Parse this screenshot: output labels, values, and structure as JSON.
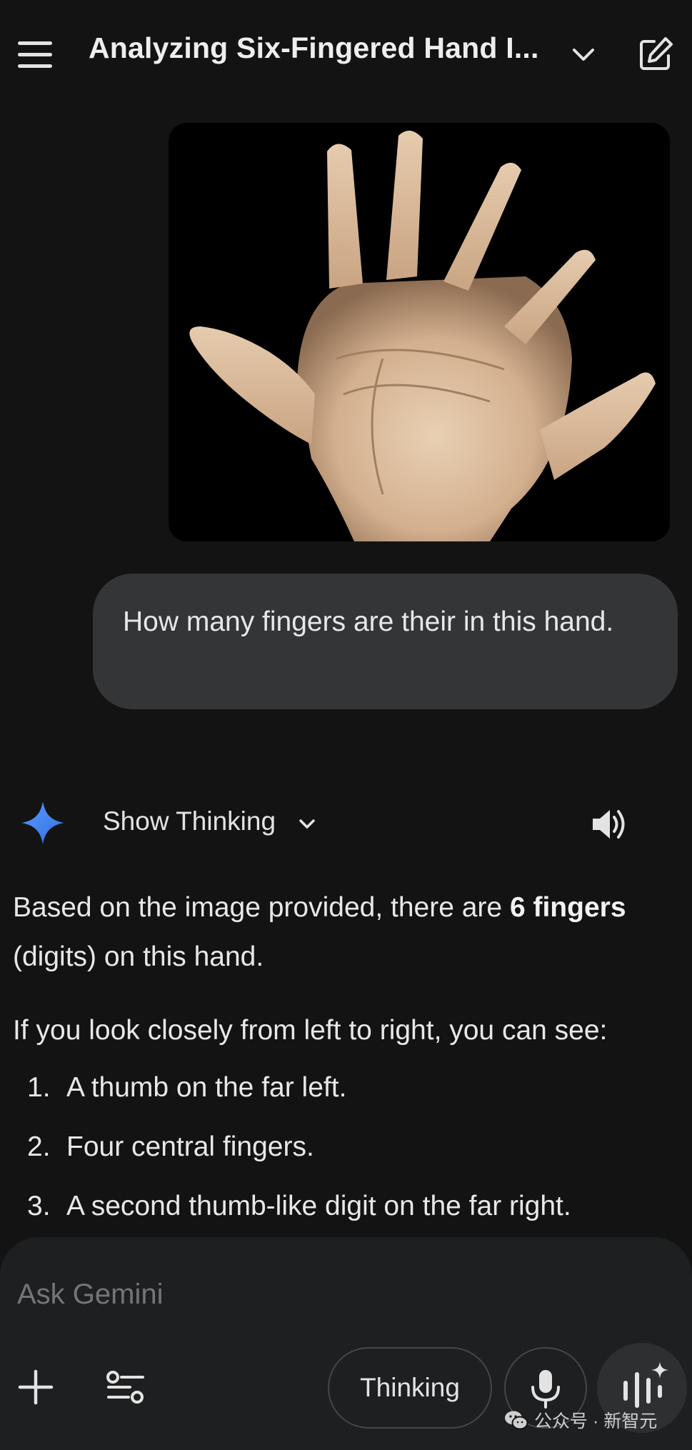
{
  "header": {
    "title": "Analyzing Six-Fingered Hand I...",
    "icons": {
      "menu": "hamburger-menu-icon",
      "dropdown": "chevron-down-icon",
      "new_chat": "edit-pencil-icon"
    }
  },
  "user_message": {
    "text": "How many fingers are their in this hand."
  },
  "response": {
    "show_thinking_label": "Show Thinking",
    "paragraph1_before": "Based on the image provided, there are ",
    "paragraph1_bold": "6 fingers",
    "paragraph1_after": " (digits) on this hand.",
    "paragraph2": "If you look closely from left to right, you can see:",
    "list": [
      {
        "num": "1.",
        "text": "A thumb on the far left."
      },
      {
        "num": "2.",
        "text": "Four central fingers."
      },
      {
        "num": "3.",
        "text": "A second thumb-like digit on the far right."
      }
    ]
  },
  "input": {
    "placeholder": "Ask Gemini",
    "thinking_label": "Thinking"
  },
  "watermark": "公众号 · 新智元",
  "colors": {
    "background": "#131314",
    "bubble": "#333537",
    "input_panel": "#1e1f20",
    "gemini_blue": "#4a8cf7"
  }
}
